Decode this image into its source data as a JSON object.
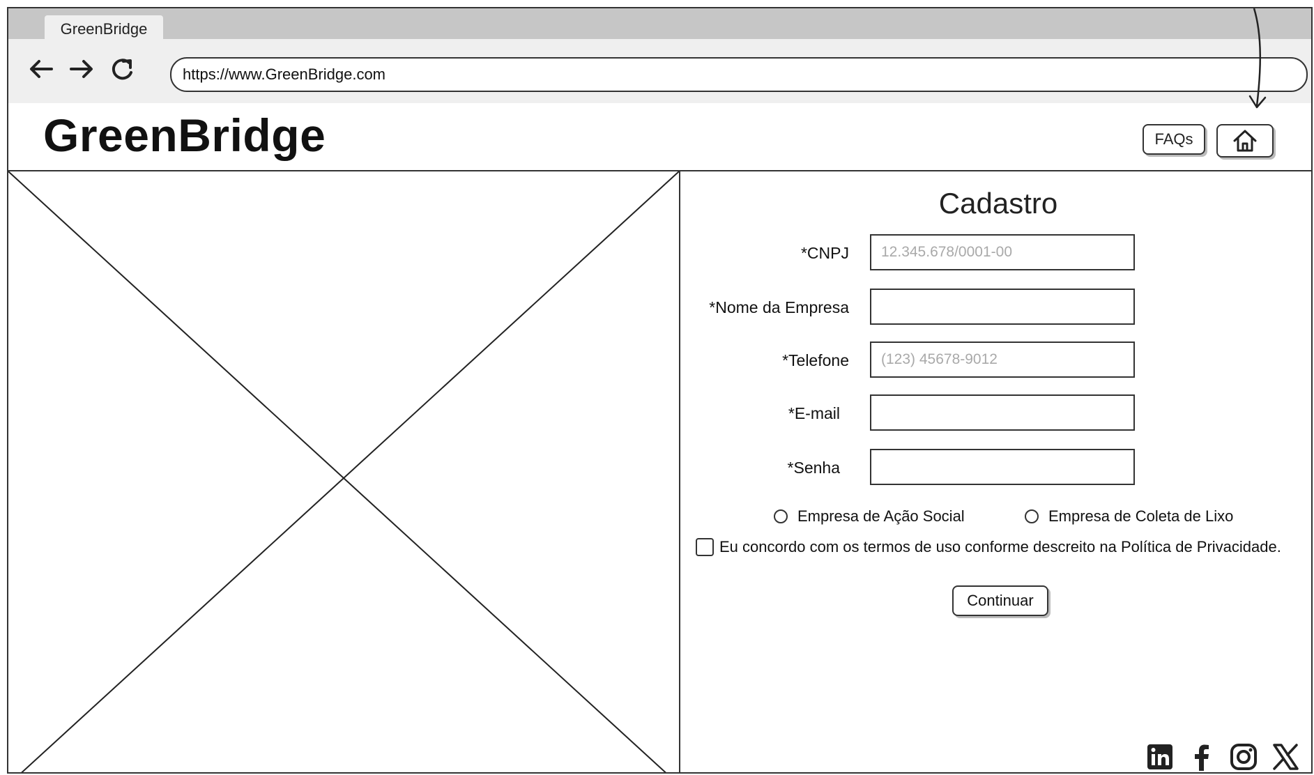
{
  "browser": {
    "tab_title": "GreenBridge",
    "url": "https://www.GreenBridge.com"
  },
  "header": {
    "logo": "GreenBridge",
    "faq_label": "FAQs",
    "home_icon": "home-icon"
  },
  "form": {
    "title": "Cadastro",
    "fields": [
      {
        "label": "*CNPJ",
        "placeholder": "12.345.678/0001-00"
      },
      {
        "label": "*Nome da Empresa",
        "placeholder": ""
      },
      {
        "label": "*Telefone",
        "placeholder": "(123) 45678-9012"
      },
      {
        "label": "*E-mail",
        "placeholder": ""
      },
      {
        "label": "*Senha",
        "placeholder": ""
      }
    ],
    "radio_options": [
      "Empresa de Ação Social",
      "Empresa de Coleta de Lixo"
    ],
    "terms_label": "Eu concordo com os termos de uso conforme descreito na Política de Privacidade.",
    "continue_label": "Continuar"
  },
  "social_icons": [
    "linkedin-icon",
    "facebook-icon",
    "instagram-icon",
    "x-icon"
  ]
}
